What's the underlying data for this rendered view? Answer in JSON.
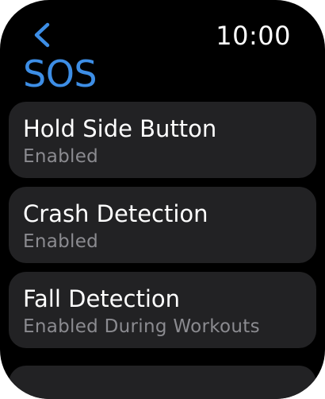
{
  "status": {
    "time": "10:00"
  },
  "header": {
    "title": "SOS",
    "back_icon": "chevron-left-icon"
  },
  "colors": {
    "accent": "#3d8ee6",
    "row_background": "#222224",
    "secondary_text": "#8b8b90"
  },
  "rows": [
    {
      "title": "Hold Side Button",
      "subtitle": "Enabled"
    },
    {
      "title": "Crash Detection",
      "subtitle": "Enabled"
    },
    {
      "title": "Fall Detection",
      "subtitle": "Enabled During Workouts"
    }
  ]
}
